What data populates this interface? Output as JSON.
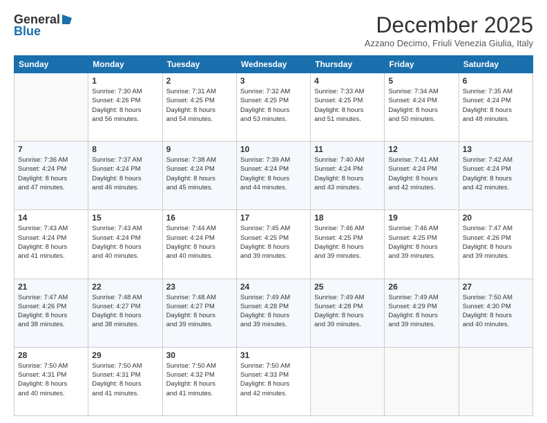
{
  "header": {
    "logo_general": "General",
    "logo_blue": "Blue",
    "month_title": "December 2025",
    "subtitle": "Azzano Decimo, Friuli Venezia Giulia, Italy"
  },
  "weekdays": [
    "Sunday",
    "Monday",
    "Tuesday",
    "Wednesday",
    "Thursday",
    "Friday",
    "Saturday"
  ],
  "weeks": [
    [
      {
        "day": "",
        "info": ""
      },
      {
        "day": "1",
        "info": "Sunrise: 7:30 AM\nSunset: 4:26 PM\nDaylight: 8 hours\nand 56 minutes."
      },
      {
        "day": "2",
        "info": "Sunrise: 7:31 AM\nSunset: 4:25 PM\nDaylight: 8 hours\nand 54 minutes."
      },
      {
        "day": "3",
        "info": "Sunrise: 7:32 AM\nSunset: 4:25 PM\nDaylight: 8 hours\nand 53 minutes."
      },
      {
        "day": "4",
        "info": "Sunrise: 7:33 AM\nSunset: 4:25 PM\nDaylight: 8 hours\nand 51 minutes."
      },
      {
        "day": "5",
        "info": "Sunrise: 7:34 AM\nSunset: 4:24 PM\nDaylight: 8 hours\nand 50 minutes."
      },
      {
        "day": "6",
        "info": "Sunrise: 7:35 AM\nSunset: 4:24 PM\nDaylight: 8 hours\nand 48 minutes."
      }
    ],
    [
      {
        "day": "7",
        "info": "Sunrise: 7:36 AM\nSunset: 4:24 PM\nDaylight: 8 hours\nand 47 minutes."
      },
      {
        "day": "8",
        "info": "Sunrise: 7:37 AM\nSunset: 4:24 PM\nDaylight: 8 hours\nand 46 minutes."
      },
      {
        "day": "9",
        "info": "Sunrise: 7:38 AM\nSunset: 4:24 PM\nDaylight: 8 hours\nand 45 minutes."
      },
      {
        "day": "10",
        "info": "Sunrise: 7:39 AM\nSunset: 4:24 PM\nDaylight: 8 hours\nand 44 minutes."
      },
      {
        "day": "11",
        "info": "Sunrise: 7:40 AM\nSunset: 4:24 PM\nDaylight: 8 hours\nand 43 minutes."
      },
      {
        "day": "12",
        "info": "Sunrise: 7:41 AM\nSunset: 4:24 PM\nDaylight: 8 hours\nand 42 minutes."
      },
      {
        "day": "13",
        "info": "Sunrise: 7:42 AM\nSunset: 4:24 PM\nDaylight: 8 hours\nand 42 minutes."
      }
    ],
    [
      {
        "day": "14",
        "info": "Sunrise: 7:43 AM\nSunset: 4:24 PM\nDaylight: 8 hours\nand 41 minutes."
      },
      {
        "day": "15",
        "info": "Sunrise: 7:43 AM\nSunset: 4:24 PM\nDaylight: 8 hours\nand 40 minutes."
      },
      {
        "day": "16",
        "info": "Sunrise: 7:44 AM\nSunset: 4:24 PM\nDaylight: 8 hours\nand 40 minutes."
      },
      {
        "day": "17",
        "info": "Sunrise: 7:45 AM\nSunset: 4:25 PM\nDaylight: 8 hours\nand 39 minutes."
      },
      {
        "day": "18",
        "info": "Sunrise: 7:46 AM\nSunset: 4:25 PM\nDaylight: 8 hours\nand 39 minutes."
      },
      {
        "day": "19",
        "info": "Sunrise: 7:46 AM\nSunset: 4:25 PM\nDaylight: 8 hours\nand 39 minutes."
      },
      {
        "day": "20",
        "info": "Sunrise: 7:47 AM\nSunset: 4:26 PM\nDaylight: 8 hours\nand 39 minutes."
      }
    ],
    [
      {
        "day": "21",
        "info": "Sunrise: 7:47 AM\nSunset: 4:26 PM\nDaylight: 8 hours\nand 38 minutes."
      },
      {
        "day": "22",
        "info": "Sunrise: 7:48 AM\nSunset: 4:27 PM\nDaylight: 8 hours\nand 38 minutes."
      },
      {
        "day": "23",
        "info": "Sunrise: 7:48 AM\nSunset: 4:27 PM\nDaylight: 8 hours\nand 39 minutes."
      },
      {
        "day": "24",
        "info": "Sunrise: 7:49 AM\nSunset: 4:28 PM\nDaylight: 8 hours\nand 39 minutes."
      },
      {
        "day": "25",
        "info": "Sunrise: 7:49 AM\nSunset: 4:28 PM\nDaylight: 8 hours\nand 39 minutes."
      },
      {
        "day": "26",
        "info": "Sunrise: 7:49 AM\nSunset: 4:29 PM\nDaylight: 8 hours\nand 39 minutes."
      },
      {
        "day": "27",
        "info": "Sunrise: 7:50 AM\nSunset: 4:30 PM\nDaylight: 8 hours\nand 40 minutes."
      }
    ],
    [
      {
        "day": "28",
        "info": "Sunrise: 7:50 AM\nSunset: 4:31 PM\nDaylight: 8 hours\nand 40 minutes."
      },
      {
        "day": "29",
        "info": "Sunrise: 7:50 AM\nSunset: 4:31 PM\nDaylight: 8 hours\nand 41 minutes."
      },
      {
        "day": "30",
        "info": "Sunrise: 7:50 AM\nSunset: 4:32 PM\nDaylight: 8 hours\nand 41 minutes."
      },
      {
        "day": "31",
        "info": "Sunrise: 7:50 AM\nSunset: 4:33 PM\nDaylight: 8 hours\nand 42 minutes."
      },
      {
        "day": "",
        "info": ""
      },
      {
        "day": "",
        "info": ""
      },
      {
        "day": "",
        "info": ""
      }
    ]
  ]
}
